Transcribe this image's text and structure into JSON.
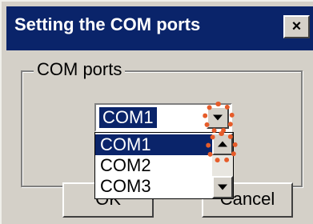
{
  "window": {
    "title": "Setting the COM ports",
    "close_label": "×"
  },
  "group": {
    "label": "COM ports"
  },
  "combo": {
    "value": "COM1",
    "arrow_icon": "triangle-down-icon"
  },
  "dropdown": {
    "options": [
      "COM1",
      "COM2",
      "COM3"
    ],
    "selected_index": 0,
    "scroll_up_icon": "triangle-up-icon",
    "scroll_down_icon": "triangle-down-icon"
  },
  "buttons": {
    "ok_label": "OK",
    "cancel_label": "Cancel"
  },
  "annotation": {
    "highlight_color": "#e65c2a"
  },
  "colors": {
    "titlebar": "#0a246a",
    "dialog_face": "#d4d0c8",
    "selection": "#0a246a"
  }
}
